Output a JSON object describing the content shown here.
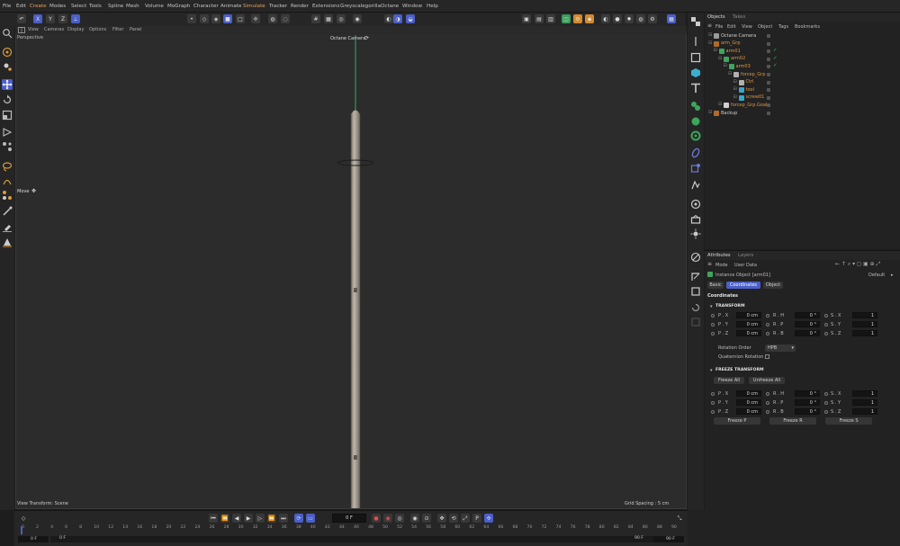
{
  "menubar": {
    "items": [
      {
        "label": "File"
      },
      {
        "label": "Edit"
      },
      {
        "label": "Create",
        "highlight": true
      },
      {
        "label": "Modes"
      },
      {
        "label": "Select"
      },
      {
        "label": "Tools"
      },
      {
        "label": "Spline"
      },
      {
        "label": "Mesh"
      },
      {
        "label": "Volume"
      },
      {
        "label": "MoGraph"
      },
      {
        "label": "Character"
      },
      {
        "label": "Animate"
      },
      {
        "label": "Simulate",
        "highlight": true
      },
      {
        "label": "Tracker"
      },
      {
        "label": "Render"
      },
      {
        "label": "Extensions"
      },
      {
        "label": "Greyscalegorilla"
      },
      {
        "label": "Octane"
      },
      {
        "label": "Window"
      },
      {
        "label": "Help"
      }
    ]
  },
  "toolbar": {
    "axis_labels": [
      "X",
      "Y",
      "Z"
    ]
  },
  "viewport": {
    "menu": [
      "View",
      "Cameras",
      "Display",
      "Options",
      "Filter",
      "Panel"
    ],
    "perspective_label": "Perspective",
    "camera_label": "Octane Camera",
    "move_label": "Move",
    "view_transform": "View Transform: Scene",
    "grid_spacing": "Grid Spacing : 5 cm"
  },
  "objects_panel": {
    "tabs": [
      "Objects",
      "Takes"
    ],
    "menu": [
      "File",
      "Edit",
      "View",
      "Object",
      "Tags",
      "Bookmarks"
    ],
    "rows": [
      {
        "name": "Octane Camera",
        "indent": 0,
        "color": "#cfcfcf",
        "icon_color": "#9a9a9a"
      },
      {
        "name": "arm_Grp",
        "indent": 0,
        "color": "#e0973f",
        "icon_color": "#b06a2a"
      },
      {
        "name": "arm01",
        "indent": 1,
        "color": "#e0973f",
        "icon_color": "#3fa55c"
      },
      {
        "name": "arm02",
        "indent": 2,
        "color": "#e0973f",
        "icon_color": "#3fa55c"
      },
      {
        "name": "arm03",
        "indent": 3,
        "color": "#e0973f",
        "icon_color": "#3fa55c"
      },
      {
        "name": "forcep_Grp",
        "indent": 4,
        "color": "#e0973f",
        "icon_color": "#b0b0b0"
      },
      {
        "name": "Ctrl",
        "indent": 5,
        "color": "#e0973f",
        "icon_color": "#b0b0b0"
      },
      {
        "name": "tool",
        "indent": 5,
        "color": "#e0973f",
        "icon_color": "#3aa6c8"
      },
      {
        "name": "screw01",
        "indent": 5,
        "color": "#e0973f",
        "icon_color": "#3aa6c8"
      },
      {
        "name": "forcep_Grp.Goal",
        "indent": 2,
        "color": "#e0973f",
        "icon_color": "#d0d0d0"
      },
      {
        "name": "Backup",
        "indent": 0,
        "color": "#cfcfcf",
        "icon_color": "#b06a2a"
      }
    ]
  },
  "attributes_panel": {
    "tabs": [
      "Attributes",
      "Layers"
    ],
    "menu": [
      "Mode",
      "User Data"
    ],
    "object_title": "Instance Object [arm01]",
    "preset": "Default",
    "sub_tabs": [
      "Basic",
      "Coordinates",
      "Object"
    ],
    "section_title": "Coordinates",
    "transform": {
      "header": "TRANSFORM",
      "rows": [
        [
          {
            "label": "P . X",
            "value": "0 cm"
          },
          {
            "label": "R . H",
            "value": "0 °"
          },
          {
            "label": "S . X",
            "value": "1"
          }
        ],
        [
          {
            "label": "P . Y",
            "value": "0 cm"
          },
          {
            "label": "R . P",
            "value": "0 °"
          },
          {
            "label": "S . Y",
            "value": "1"
          }
        ],
        [
          {
            "label": "P . Z",
            "value": "0 cm"
          },
          {
            "label": "R . B",
            "value": "0 °"
          },
          {
            "label": "S . Z",
            "value": "1"
          }
        ]
      ],
      "rotation_order_label": "Rotation Order",
      "rotation_order_value": "HPB",
      "quaternion_label": "Quaternion Rotation"
    },
    "freeze": {
      "header": "FREEZE TRANSFORM",
      "freeze_all": "Freeze All",
      "unfreeze_all": "Unfreeze All",
      "rows": [
        [
          {
            "label": "P . X",
            "value": "0 cm"
          },
          {
            "label": "R . H",
            "value": "0 °"
          },
          {
            "label": "S . X",
            "value": "1"
          }
        ],
        [
          {
            "label": "P . Y",
            "value": "0 cm"
          },
          {
            "label": "R . P",
            "value": "0 °"
          },
          {
            "label": "S . Y",
            "value": "1"
          }
        ],
        [
          {
            "label": "P . Z",
            "value": "0 cm"
          },
          {
            "label": "R . B",
            "value": "0 °"
          },
          {
            "label": "S . Z",
            "value": "1"
          }
        ]
      ],
      "freeze_p": "Freeze P",
      "freeze_r": "Freeze R",
      "freeze_s": "Freeze S"
    }
  },
  "timeline": {
    "current_frame": "0 F",
    "start": "0 F",
    "start2": "0 F",
    "end": "90 F",
    "end2": "90 F",
    "ticks": [
      "0",
      "2",
      "4",
      "6",
      "8",
      "10",
      "12",
      "14",
      "16",
      "18",
      "20",
      "22",
      "24",
      "26",
      "28",
      "30",
      "32",
      "34",
      "36",
      "38",
      "40",
      "42",
      "44",
      "46",
      "48",
      "50",
      "52",
      "54",
      "56",
      "58",
      "60",
      "62",
      "64",
      "66",
      "68",
      "70",
      "72",
      "74",
      "76",
      "78",
      "80",
      "82",
      "84",
      "86",
      "88",
      "90"
    ]
  },
  "colors": {
    "accent": "#4b5fc8",
    "highlight": "#e0973f",
    "axis_green": "#2fa86a"
  }
}
